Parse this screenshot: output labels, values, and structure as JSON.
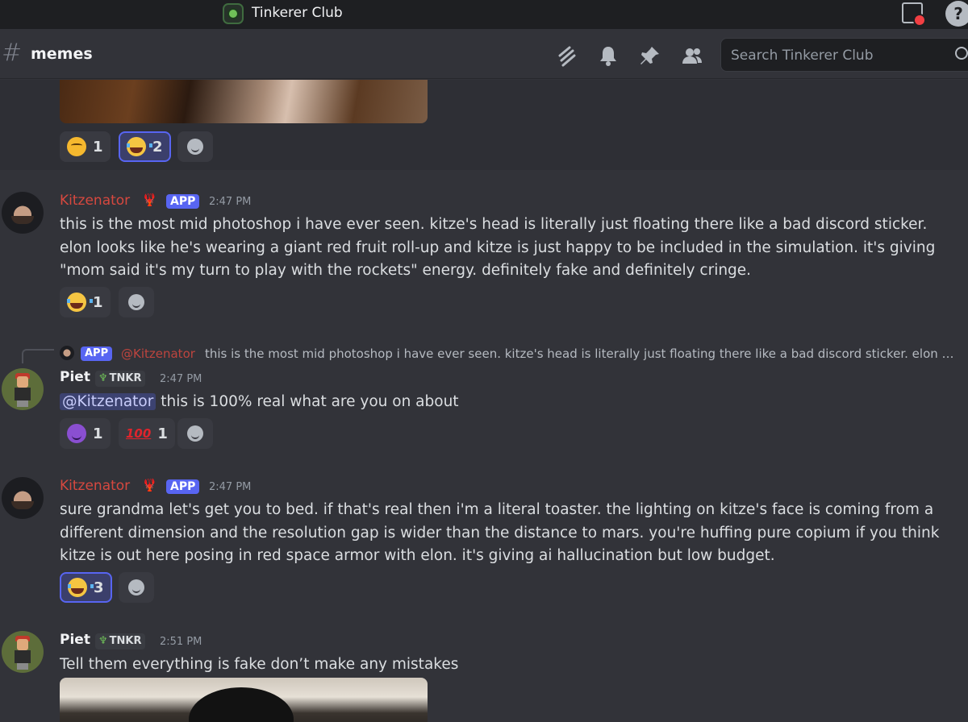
{
  "titlebar": {
    "server_name": "Tinkerer Club"
  },
  "channel": {
    "name": "memes",
    "search_placeholder": "Search Tinkerer Club"
  },
  "top_reactions": [
    {
      "emoji": "thinking",
      "count": "1"
    },
    {
      "emoji": "joy",
      "count": "2",
      "active": true
    }
  ],
  "messages": [
    {
      "author": "Kitzenator",
      "app_badge": "APP",
      "time": "2:47 PM",
      "text": "this is the most mid photoshop i have ever seen. kitze's head is literally just floating there like a bad discord sticker. elon looks like he's wearing a giant red fruit roll-up and kitze is just happy to be included in the simulation. it's giving \"mom said it's my turn to play with the rockets\" energy. definitely fake and definitely cringe.",
      "reactions": [
        {
          "emoji": "joy",
          "count": "1"
        }
      ]
    },
    {
      "reply": {
        "badge": "APP",
        "user": "@Kitzenator",
        "text": "this is the most mid photoshop i have ever seen. kitze's head is literally just floating there like a bad discord sticker. elon looks like he's wearing a giant red fruit roll-up and kitze is just happy to be included in the simulation."
      },
      "author": "Piet",
      "tag": "TNKR",
      "time": "2:47 PM",
      "mention": "@Kitzenator",
      "text": "this is 100% real what are you on about",
      "reactions": [
        {
          "emoji": "smiling_imp",
          "count": "1"
        },
        {
          "emoji": "100",
          "count": "1"
        }
      ]
    },
    {
      "author": "Kitzenator",
      "app_badge": "APP",
      "time": "2:47 PM",
      "text": "sure grandma let's get you to bed. if that's real then i'm a literal toaster. the lighting on kitze's face is coming from a different dimension and the resolution gap is wider than the distance to mars. you're huffing pure copium if you think kitze is out here posing in red space armor with elon. it's giving ai hallucination but low budget.",
      "reactions": [
        {
          "emoji": "joy",
          "count": "3",
          "active": true
        }
      ]
    },
    {
      "author": "Piet",
      "tag": "TNKR",
      "time": "2:51 PM",
      "text": "Tell them everything is fake don’t make any mistakes"
    }
  ]
}
